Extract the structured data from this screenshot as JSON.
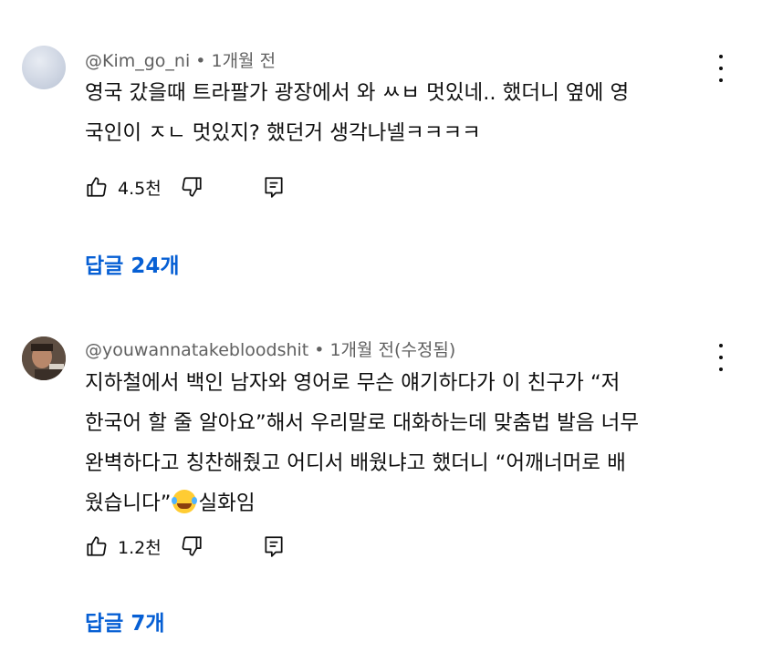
{
  "comments": [
    {
      "handle": "@Kim_go_ni",
      "time": "1개월 전",
      "lines": [
        "영국 갔을때 트라팔가 광장에서 와 ㅆㅂ 멋있네.. 했더니 옆에 영",
        "국인이 ㅈㄴ 멋있지? 했던거 생각나넬ㅋㅋㅋㅋ"
      ],
      "likes": "4.5천",
      "replies": "답글 24개"
    },
    {
      "handle": "@youwannatakebloodshit",
      "time": "1개월 전(수정됨)",
      "lines": [
        "지하철에서 백인 남자와 영어로 무슨 얘기하다가 이 친구가 “저",
        "한국어 할 줄 알아요”해서 우리말로 대화하는데 맞춤법 발음 너무",
        "완벽하다고 칭찬해줬고 어디서 배웠냐고 했더니 “어깨너머로 배",
        "웠습니다”"
      ],
      "line4_suffix": "실화임",
      "emoji": "laughing-tears-emoji",
      "likes": "1.2천",
      "replies": "답글 7개"
    }
  ],
  "icons": {
    "like": "thumbs-up-icon",
    "dislike": "thumbs-down-icon",
    "reply": "reply-comment-icon",
    "more": "more-vert-icon"
  },
  "colors": {
    "text": "#0f0f0f",
    "meta": "#606060",
    "link": "#065fd4"
  }
}
